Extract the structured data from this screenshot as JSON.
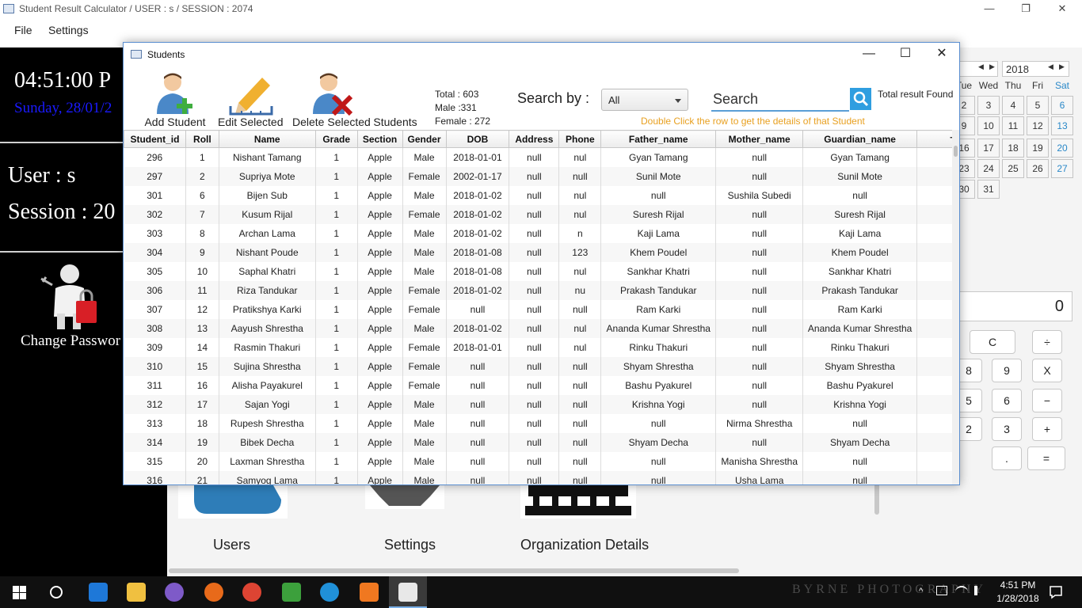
{
  "window": {
    "title": "Student Result Calculator /   USER : s   /   SESSION : 2074",
    "minimize": "—",
    "restore": "❐",
    "close": "✕"
  },
  "menu": {
    "file": "File",
    "settings": "Settings"
  },
  "left_panel": {
    "time": "04:51:00 P",
    "date": "Sunday, 28/01/2",
    "user": "User : s",
    "session": "Session : 20",
    "change_password": "Change Passwor"
  },
  "center": {
    "tiles": {
      "users": "Users",
      "settings": "Settings",
      "organization": "Organization Details"
    }
  },
  "calendar": {
    "year": "2018",
    "prev": "◀",
    "next": "▶",
    "dow": [
      "Tue",
      "Wed",
      "Thu",
      "Fri",
      "Sat"
    ],
    "rows": [
      [
        "2",
        "3",
        "4",
        "5",
        "6"
      ],
      [
        "9",
        "10",
        "11",
        "12",
        "13"
      ],
      [
        "16",
        "17",
        "18",
        "19",
        "20"
      ],
      [
        "23",
        "24",
        "25",
        "26",
        "27"
      ],
      [
        "30",
        "31",
        "",
        "",
        ""
      ]
    ]
  },
  "calculator": {
    "display": "0",
    "buttons": [
      "C",
      "÷",
      "8",
      "9",
      "X",
      "5",
      "6",
      "−",
      "2",
      "3",
      "+",
      ".",
      "="
    ]
  },
  "dialog": {
    "title": "Students",
    "min": "—",
    "max": "☐",
    "close": "✕",
    "toolbar": {
      "add": "Add Student",
      "edit": "Edit Selected",
      "delete": "Delete Selected",
      "students": "Students"
    },
    "stats": {
      "total": "Total : 603",
      "male": "Male :331",
      "female": "Female : 272"
    },
    "search_by_label": "Search by :",
    "search_by_value": "All",
    "search_placeholder": "Search",
    "total_found": "Total result Found",
    "hint": "Double Click the row to get the details of that Student",
    "add_column": "+",
    "columns": [
      "Student_id",
      "Roll",
      "Name",
      "Grade",
      "Section",
      "Gender",
      "DOB",
      "Address",
      "Phone",
      "Father_name",
      "Mother_name",
      "Guardian_name"
    ],
    "rows": [
      [
        "296",
        "1",
        "Nishant Tamang",
        "1",
        "Apple",
        "Male",
        "2018-01-01",
        "null",
        "nul",
        "Gyan Tamang",
        "null",
        "Gyan Tamang"
      ],
      [
        "297",
        "2",
        "Supriya Mote",
        "1",
        "Apple",
        "Female",
        "2002-01-17",
        "null",
        "null",
        "Sunil Mote",
        "null",
        "Sunil Mote"
      ],
      [
        "301",
        "6",
        "Bijen Sub",
        "1",
        "Apple",
        "Male",
        "2018-01-02",
        "null",
        "nul",
        "null",
        "Sushila Subedi",
        "null"
      ],
      [
        "302",
        "7",
        "Kusum Rijal",
        "1",
        "Apple",
        "Female",
        "2018-01-02",
        "null",
        "nul",
        "Suresh Rijal",
        "null",
        "Suresh Rijal"
      ],
      [
        "303",
        "8",
        "Archan Lama",
        "1",
        "Apple",
        "Male",
        "2018-01-02",
        "null",
        "n",
        "Kaji Lama",
        "null",
        "Kaji Lama"
      ],
      [
        "304",
        "9",
        "Nishant Poude",
        "1",
        "Apple",
        "Male",
        "2018-01-08",
        "null",
        "123",
        "Khem Poudel",
        "null",
        "Khem Poudel"
      ],
      [
        "305",
        "10",
        "Saphal Khatri",
        "1",
        "Apple",
        "Male",
        "2018-01-08",
        "null",
        "nul",
        "Sankhar Khatri",
        "null",
        "Sankhar Khatri"
      ],
      [
        "306",
        "11",
        "Riza Tandukar",
        "1",
        "Apple",
        "Female",
        "2018-01-02",
        "null",
        "nu",
        "Prakash Tandukar",
        "null",
        "Prakash Tandukar"
      ],
      [
        "307",
        "12",
        "Pratikshya Karki",
        "1",
        "Apple",
        "Female",
        "null",
        "null",
        "null",
        "Ram Karki",
        "null",
        "Ram Karki"
      ],
      [
        "308",
        "13",
        "Aayush Shrestha",
        "1",
        "Apple",
        "Male",
        "2018-01-02",
        "null",
        "nul",
        "Ananda Kumar Shrestha",
        "null",
        "Ananda Kumar Shrestha"
      ],
      [
        "309",
        "14",
        "Rasmin Thakuri",
        "1",
        "Apple",
        "Female",
        "2018-01-01",
        "null",
        "nul",
        "Rinku Thakuri",
        "null",
        "Rinku Thakuri"
      ],
      [
        "310",
        "15",
        "Sujina Shrestha",
        "1",
        "Apple",
        "Female",
        "null",
        "null",
        "null",
        "Shyam Shrestha",
        "null",
        "Shyam Shrestha"
      ],
      [
        "311",
        "16",
        "Alisha Payakurel",
        "1",
        "Apple",
        "Female",
        "null",
        "null",
        "null",
        "Bashu  Pyakurel",
        "null",
        "Bashu  Pyakurel"
      ],
      [
        "312",
        "17",
        "Sajan Yogi",
        "1",
        "Apple",
        "Male",
        "null",
        "null",
        "null",
        "Krishna Yogi",
        "null",
        "Krishna Yogi"
      ],
      [
        "313",
        "18",
        "Rupesh Shrestha",
        "1",
        "Apple",
        "Male",
        "null",
        "null",
        "null",
        "null",
        "Nirma Shrestha",
        "null"
      ],
      [
        "314",
        "19",
        "Bibek Decha",
        "1",
        "Apple",
        "Male",
        "null",
        "null",
        "null",
        "Shyam Decha",
        "null",
        "Shyam Decha"
      ],
      [
        "315",
        "20",
        "Laxman Shrestha",
        "1",
        "Apple",
        "Male",
        "null",
        "null",
        "null",
        "null",
        "Manisha Shrestha",
        "null"
      ],
      [
        "316",
        "21",
        "Samyog Lama",
        "1",
        "Apple",
        "Male",
        "null",
        "null",
        "null",
        "null",
        "Usha Lama",
        "null"
      ]
    ]
  },
  "taskbar": {
    "time": "4:51 PM",
    "date": "1/28/2018",
    "watermark": "BYRNE PHOTOGRAPHY",
    "apps": [
      "start-icon",
      "cortana-icon",
      "edge-icon",
      "file-explorer-icon",
      "viber-icon",
      "firefox-icon",
      "chrome-icon",
      "maps-icon",
      "sync-icon",
      "xampp-icon",
      "java-icon"
    ]
  }
}
